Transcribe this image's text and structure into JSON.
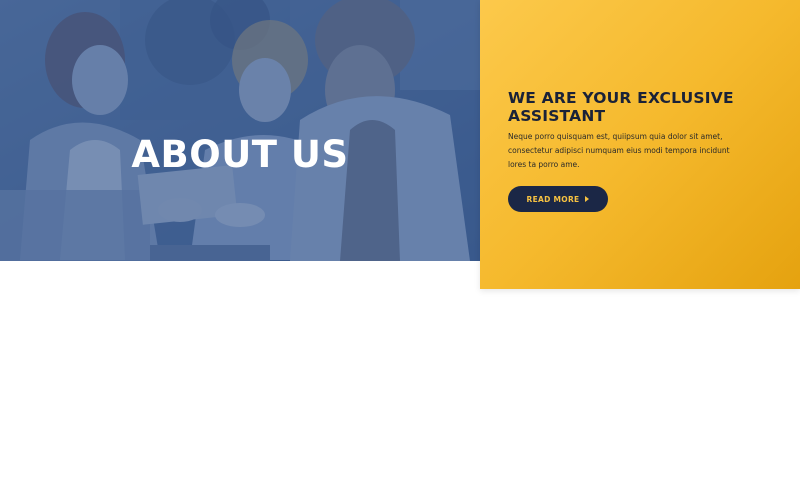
{
  "hero": {
    "title": "ABOUT US"
  },
  "card": {
    "heading": "WE ARE YOUR EXCLUSIVE ASSISTANT",
    "text": "Neque porro quisquam est, quiipsum quia dolor sit amet, consectetur adipisci numquam eius modi tempora incidunt lores ta porro ame.",
    "button_label": "READ MORE",
    "button_icon": "caret-right-icon"
  },
  "colors": {
    "hero_overlay": "#36578c",
    "card_yellow": "#f7bf3a",
    "button_navy": "#1b2746",
    "button_text": "#f7c242",
    "heading_dark": "#1a2238"
  }
}
